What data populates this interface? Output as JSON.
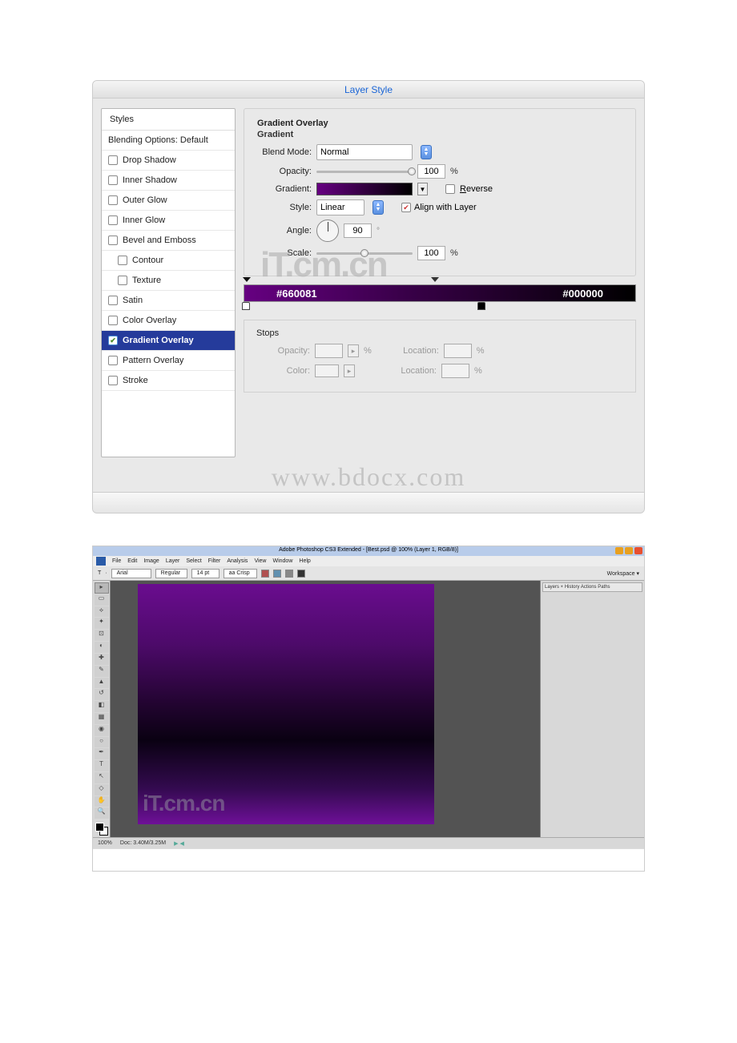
{
  "dialog": {
    "title": "Layer Style",
    "styles_header": "Styles",
    "items": [
      {
        "label": "Blending Options: Default",
        "box": false
      },
      {
        "label": "Drop Shadow",
        "box": true
      },
      {
        "label": "Inner Shadow",
        "box": true
      },
      {
        "label": "Outer Glow",
        "box": true
      },
      {
        "label": "Inner Glow",
        "box": true
      },
      {
        "label": "Bevel and Emboss",
        "box": true
      },
      {
        "label": "Contour",
        "box": true,
        "indent": true
      },
      {
        "label": "Texture",
        "box": true,
        "indent": true
      },
      {
        "label": "Satin",
        "box": true
      },
      {
        "label": "Color Overlay",
        "box": true
      },
      {
        "label": "Gradient Overlay",
        "box": true,
        "checked": true,
        "selected": true
      },
      {
        "label": "Pattern Overlay",
        "box": true
      },
      {
        "label": "Stroke",
        "box": true
      }
    ]
  },
  "panel": {
    "title": "Gradient Overlay",
    "group": "Gradient",
    "blend_mode_label": "Blend Mode:",
    "blend_mode_value": "Normal",
    "opacity_label": "Opacity:",
    "opacity_value": "100",
    "percent": "%",
    "gradient_label": "Gradient:",
    "reverse_label": "Reverse",
    "style_label": "Style:",
    "style_value": "Linear",
    "align_label": "Align with Layer",
    "angle_label": "Angle:",
    "angle_value": "90",
    "scale_label": "Scale:",
    "scale_value": "100"
  },
  "grad_editor": {
    "left_hex": "#660081",
    "right_hex": "#000000"
  },
  "stops": {
    "legend": "Stops",
    "opacity_label": "Opacity:",
    "location_label": "Location:",
    "color_label": "Color:",
    "percent": "%"
  },
  "watermarks": {
    "itcmn": "iT.cm.cn",
    "bdocx": "www.bdocx.com"
  },
  "ps": {
    "title": "Adobe Photoshop CS3 Extended - [Best.psd @ 100% (Layer 1, RGB/8)]",
    "menu": [
      "File",
      "Edit",
      "Image",
      "Layer",
      "Select",
      "Filter",
      "Analysis",
      "View",
      "Window",
      "Help"
    ],
    "options": {
      "t": "T",
      "font": "Arial",
      "weight": "Regular",
      "size": "14 pt",
      "aa": "aa Crisp",
      "workspace": "Workspace ▾"
    },
    "right_tabs": "Layers × History Actions Paths",
    "status_zoom": "100%",
    "status_doc": "Doc: 3.40M/3.25M",
    "wm": "iT.cm.cn"
  }
}
